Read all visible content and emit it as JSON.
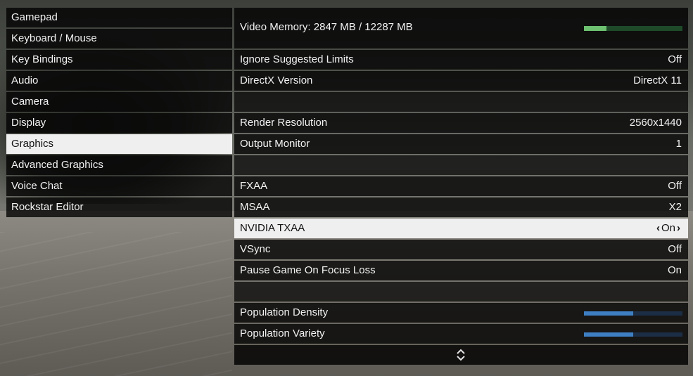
{
  "menu": {
    "items": [
      {
        "label": "Gamepad"
      },
      {
        "label": "Keyboard / Mouse"
      },
      {
        "label": "Key Bindings"
      },
      {
        "label": "Audio"
      },
      {
        "label": "Camera"
      },
      {
        "label": "Display"
      },
      {
        "label": "Graphics",
        "selected": true
      },
      {
        "label": "Advanced Graphics"
      },
      {
        "label": "Voice Chat"
      },
      {
        "label": "Rockstar Editor"
      }
    ]
  },
  "vram": {
    "label": "Video Memory: 2847 MB / 12287 MB",
    "used_mb": 2847,
    "total_mb": 12287,
    "bar_color": "#6cc070"
  },
  "settings": [
    {
      "label": "Ignore Suggested Limits",
      "value": "Off"
    },
    {
      "label": "DirectX Version",
      "value": "DirectX 11"
    },
    {
      "spacer": true
    },
    {
      "label": "Render Resolution",
      "value": "2560x1440"
    },
    {
      "label": "Output Monitor",
      "value": "1"
    },
    {
      "spacer": true
    },
    {
      "label": "FXAA",
      "value": "Off"
    },
    {
      "label": "MSAA",
      "value": "X2"
    },
    {
      "label": "NVIDIA TXAA",
      "value": "On",
      "selected": true
    },
    {
      "label": "VSync",
      "value": "Off"
    },
    {
      "label": "Pause Game On Focus Loss",
      "value": "On"
    },
    {
      "spacer": true
    },
    {
      "label": "Population Density",
      "slider": 0.5
    },
    {
      "label": "Population Variety",
      "slider": 0.5
    }
  ],
  "selector_arrows": {
    "left": "‹",
    "right": "›"
  },
  "scroll_icon": "up-down-chevron-icon",
  "colors": {
    "slider_fill": "#3e7fc4",
    "slider_track": "#1c2e46",
    "selection_bg": "#efefef"
  }
}
